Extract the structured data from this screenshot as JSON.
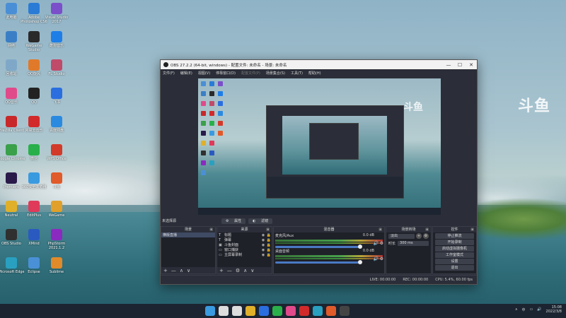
{
  "desktop": {
    "brand_logo": "斗鱼",
    "icons": [
      {
        "label": "此电脑",
        "color": "#4a8fd6"
      },
      {
        "label": "Adobe Photoshop CS6",
        "color": "#2a7bd6"
      },
      {
        "label": "Visual Studio 2017",
        "color": "#7a4fc9"
      },
      {
        "label": "网络",
        "color": "#3a7fc6"
      },
      {
        "label": "WeGame Studio",
        "color": "#2a2a2a"
      },
      {
        "label": "酷狗音乐",
        "color": "#1e7ee8"
      },
      {
        "label": "回收站",
        "color": "#7fa8c8"
      },
      {
        "label": "QQ旋风",
        "color": "#e07a2a"
      },
      {
        "label": "FL Studio",
        "color": "#c04a6a"
      },
      {
        "label": "QQ音乐",
        "color": "#e04a8a"
      },
      {
        "label": "QQ",
        "color": "#222222"
      },
      {
        "label": "飞书",
        "color": "#2a6ee0"
      },
      {
        "label": "FileZilla Client",
        "color": "#c8282a"
      },
      {
        "label": "网易云音乐",
        "color": "#d22a2a"
      },
      {
        "label": "百度网盘",
        "color": "#2a8ae0"
      },
      {
        "label": "Google Chrome",
        "color": "#3aa04a"
      },
      {
        "label": "微信",
        "color": "#2ab04a"
      },
      {
        "label": "WPS Office",
        "color": "#d23a2a"
      },
      {
        "label": "Premiere",
        "color": "#2a1a4a"
      },
      {
        "label": "360安全浏览器",
        "color": "#3a9ae0"
      },
      {
        "label": "斗鱼",
        "color": "#e05a2a"
      },
      {
        "label": "Neutral",
        "color": "#e0b02a"
      },
      {
        "label": "EditPlus",
        "color": "#e03a5a"
      },
      {
        "label": "WeGame",
        "color": "#e0a02a"
      },
      {
        "label": "OBS Studio",
        "color": "#303030"
      },
      {
        "label": "XMind",
        "color": "#2a5ac0"
      },
      {
        "label": "PhpStorm 2021.1.2",
        "color": "#8a2ac0"
      },
      {
        "label": "Microsoft Edge",
        "color": "#2aa0c0"
      },
      {
        "label": "Eclipse",
        "color": "#4a90d6"
      },
      {
        "label": "Sublime",
        "color": "#e08a2a"
      }
    ]
  },
  "obs": {
    "title": "OBS 27.2.2 (64-bit, windows) - 配置文件: 未命名 - 场景: 未命名",
    "window_controls": {
      "minimize": "—",
      "maximize": "☐",
      "close": "✕"
    },
    "menu": [
      {
        "label": "文件(F)",
        "disabled": false
      },
      {
        "label": "编辑(E)",
        "disabled": false
      },
      {
        "label": "视图(V)",
        "disabled": false
      },
      {
        "label": "停靠窗口(D)",
        "disabled": false
      },
      {
        "label": "配置文件(P)",
        "disabled": true
      },
      {
        "label": "场景集合(S)",
        "disabled": false
      },
      {
        "label": "工具(T)",
        "disabled": false
      },
      {
        "label": "帮助(H)",
        "disabled": false
      }
    ],
    "preview_logo": "斗鱼",
    "current_scene_label": "未选择源",
    "filter_buttons": [
      {
        "icon": "⚙",
        "label": "属性"
      },
      {
        "icon": "◐",
        "label": "滤镜"
      }
    ],
    "scenes_dock": {
      "title": "场景",
      "items": [
        "横版直播"
      ]
    },
    "sources_dock": {
      "title": "来源",
      "items": [
        {
          "type": "T",
          "name": "标题"
        },
        {
          "type": "T",
          "name": "弹幕"
        },
        {
          "type": "▣",
          "name": "斗鱼封面"
        },
        {
          "type": "▭",
          "name": "窗口捕获"
        },
        {
          "type": "▭",
          "name": "主屏幕录制"
        }
      ]
    },
    "mixer_dock": {
      "title": "混音器",
      "channels": [
        {
          "name": "麦克风/Aux",
          "db": "0.0 dB"
        },
        {
          "name": "桌面音频",
          "db": "0.0 dB"
        }
      ]
    },
    "transitions_dock": {
      "title": "场景转场",
      "transition": "淡出",
      "duration_label": "时长",
      "duration": "300 ms"
    },
    "controls_dock": {
      "title": "控件",
      "buttons": [
        "停止推流",
        "开始录制",
        "启动虚拟摄像机",
        "工作室模式",
        "设置",
        "退出"
      ]
    },
    "status": {
      "live": "LIVE: 00:00:00",
      "rec": "REC: 00:00:00",
      "cpu": "CPU: 5.4%, 60.00 fps"
    },
    "footer_icons": [
      "+",
      "—",
      "∧",
      "∨"
    ]
  },
  "taskbar": {
    "icons": [
      {
        "name": "windows-start",
        "color": "#3a9ae0"
      },
      {
        "name": "search",
        "color": "#dddddd"
      },
      {
        "name": "task-view",
        "color": "#dddddd"
      },
      {
        "name": "file-explorer",
        "color": "#e0b02a"
      },
      {
        "name": "feishu",
        "color": "#2a6ee0"
      },
      {
        "name": "wechat",
        "color": "#2ab04a"
      },
      {
        "name": "qq-music",
        "color": "#e04a8a"
      },
      {
        "name": "netease-music",
        "color": "#d22a2a"
      },
      {
        "name": "edge",
        "color": "#2aa0c0"
      },
      {
        "name": "douyu",
        "color": "#e05a2a"
      },
      {
        "name": "obs",
        "color": "#444444"
      }
    ],
    "tray": {
      "lang": "中",
      "time": "15:08",
      "date": "2022/3/8"
    }
  }
}
